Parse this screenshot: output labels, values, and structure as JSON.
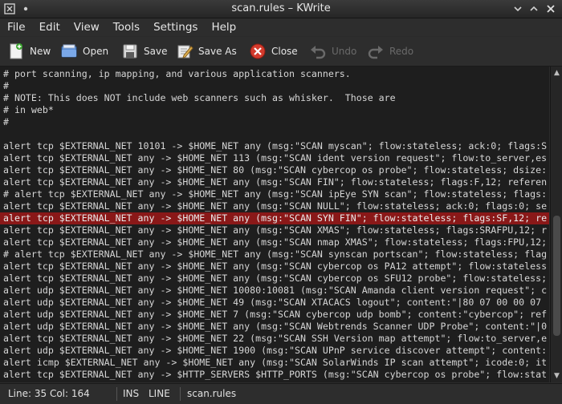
{
  "window": {
    "title": "scan.rules – KWrite"
  },
  "menu": [
    "File",
    "Edit",
    "View",
    "Tools",
    "Settings",
    "Help"
  ],
  "toolbar": {
    "new": "New",
    "open": "Open",
    "save": "Save",
    "save_as": "Save As",
    "close": "Close",
    "undo": "Undo",
    "redo": "Redo"
  },
  "editor": {
    "lines": [
      "# port scanning, ip mapping, and various application scanners.",
      "#",
      "# NOTE: This does NOT include web scanners such as whisker.  Those are",
      "# in web*",
      "#",
      "",
      "alert tcp $EXTERNAL_NET 10101 -> $HOME_NET any (msg:\"SCAN myscan\"; flow:stateless; ack:0; flags:S",
      "alert tcp $EXTERNAL_NET any -> $HOME_NET 113 (msg:\"SCAN ident version request\"; flow:to_server,es",
      "alert tcp $EXTERNAL_NET any -> $HOME_NET 80 (msg:\"SCAN cybercop os probe\"; flow:stateless; dsize:",
      "alert tcp $EXTERNAL_NET any -> $HOME_NET any (msg:\"SCAN FIN\"; flow:stateless; flags:F,12; referen",
      "# alert tcp $EXTERNAL_NET any -> $HOME_NET any (msg:\"SCAN ipEye SYN scan\"; flow:stateless; flags:",
      "alert tcp $EXTERNAL_NET any -> $HOME_NET any (msg:\"SCAN NULL\"; flow:stateless; ack:0; flags:0; se",
      "alert tcp $EXTERNAL_NET any -> $HOME_NET any (msg:\"SCAN SYN FIN\"; flow:stateless; flags:SF,12; re",
      "alert tcp $EXTERNAL_NET any -> $HOME_NET any (msg:\"SCAN XMAS\"; flow:stateless; flags:SRAFPU,12; r",
      "alert tcp $EXTERNAL_NET any -> $HOME_NET any (msg:\"SCAN nmap XMAS\"; flow:stateless; flags:FPU,12;",
      "# alert tcp $EXTERNAL_NET any -> $HOME_NET any (msg:\"SCAN synscan portscan\"; flow:stateless; flag",
      "alert tcp $EXTERNAL_NET any -> $HOME_NET any (msg:\"SCAN cybercop os PA12 attempt\"; flow:stateless",
      "alert tcp $EXTERNAL_NET any -> $HOME_NET any (msg:\"SCAN cybercop os SFU12 probe\"; flow:stateless;",
      "alert udp $EXTERNAL_NET any -> $HOME_NET 10080:10081 (msg:\"SCAN Amanda client version request\"; c",
      "alert udp $EXTERNAL_NET any -> $HOME_NET 49 (msg:\"SCAN XTACACS logout\"; content:\"|80 07 00 00 07",
      "alert udp $EXTERNAL_NET any -> $HOME_NET 7 (msg:\"SCAN cybercop udp bomb\"; content:\"cybercop\"; ref",
      "alert udp $EXTERNAL_NET any -> $HOME_NET any (msg:\"SCAN Webtrends Scanner UDP Probe\"; content:\"|0",
      "alert tcp $EXTERNAL_NET any -> $HOME_NET 22 (msg:\"SCAN SSH Version map attempt\"; flow:to_server,e",
      "alert udp $EXTERNAL_NET any -> $HOME_NET 1900 (msg:\"SCAN UPnP service discover attempt\"; content:",
      "alert icmp $EXTERNAL_NET any -> $HOME_NET any (msg:\"SCAN SolarWinds IP scan attempt\"; icode:0; it",
      "alert tcp $EXTERNAL_NET any -> $HTTP_SERVERS $HTTP_PORTS (msg:\"SCAN cybercop os probe\"; flow:stat"
    ],
    "highlighted_line_index": 12,
    "highlight_color": "#8a1818"
  },
  "status": {
    "position": "Line: 35 Col: 164",
    "mode": "INS",
    "selection": "LINE",
    "filename": "scan.rules"
  }
}
